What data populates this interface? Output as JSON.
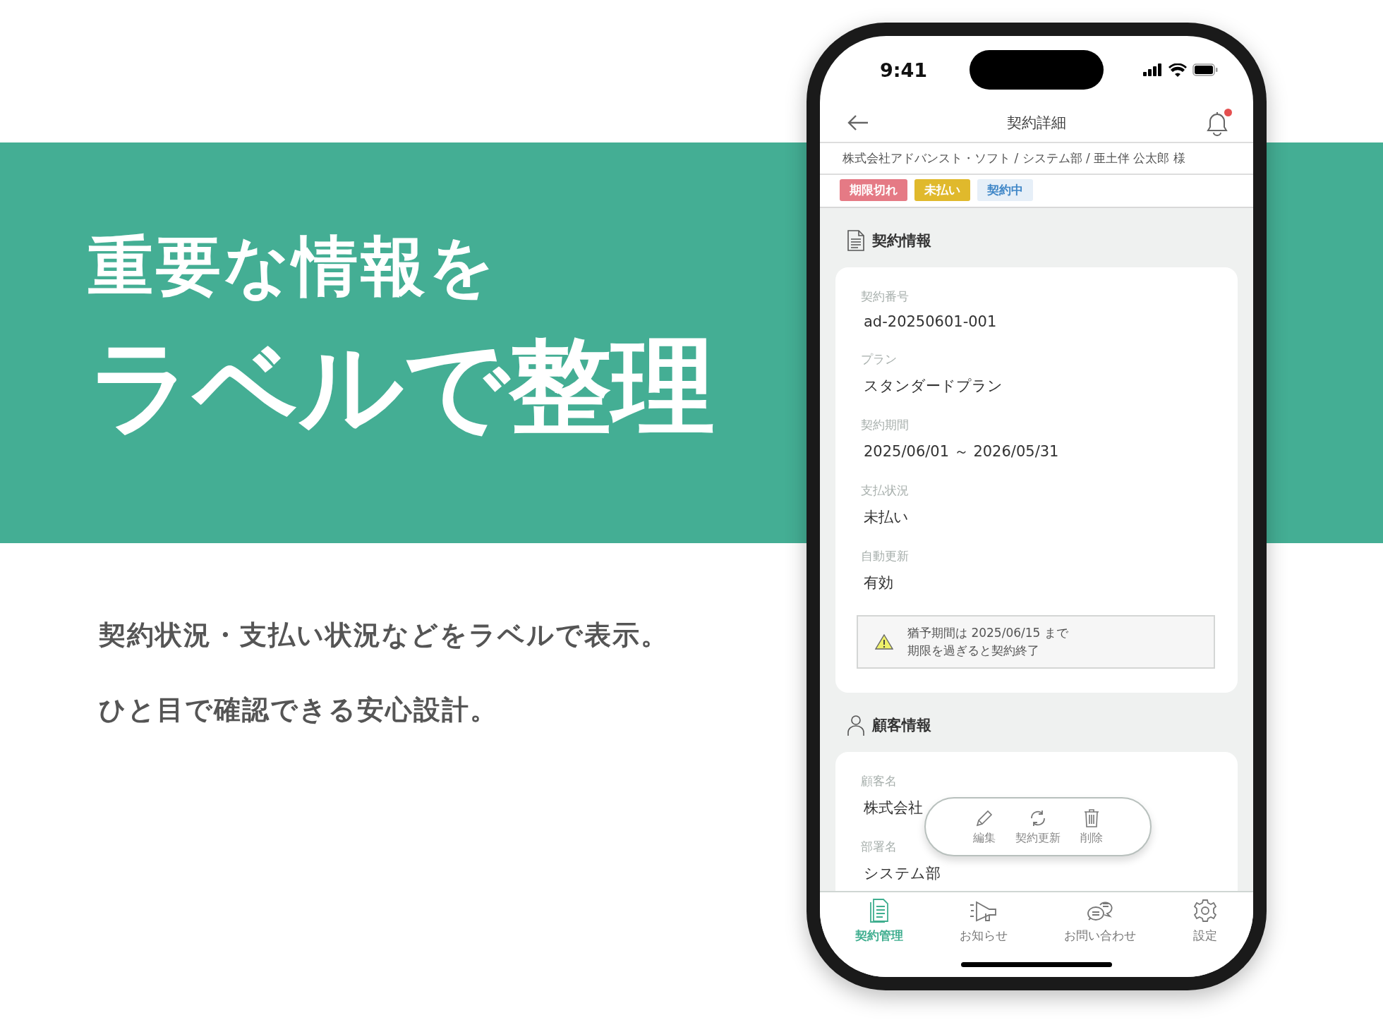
{
  "headline": {
    "line_1": "重要な情報を",
    "line_2": "ラベルで整理"
  },
  "description": [
    "契約状況・支払い状況などをラベルで表示。",
    "ひと目で確認できる安心設計。"
  ],
  "status_bar": {
    "time": "9:41"
  },
  "header": {
    "title": "契約詳細",
    "notification_badge": true
  },
  "breadcrumb": "株式会社アドバンスト・ソフト / システム部 / 亜土伴 公太郎 様",
  "labels": [
    {
      "text": "期限切れ",
      "color": "#e57a85"
    },
    {
      "text": "未払い",
      "color": "#e0b92c"
    },
    {
      "text": "契約中",
      "color": "#e6eff8"
    }
  ],
  "sections": [
    {
      "kind": "contract",
      "title": "契約情報",
      "fields": [
        {
          "label": "契約番号",
          "value": "ad-20250601-001"
        },
        {
          "label": "プラン",
          "value": "スタンダードプラン"
        },
        {
          "label": "契約期間",
          "value": "2025/06/01 ～ 2026/05/31"
        },
        {
          "label": "支払状況",
          "value": "未払い"
        },
        {
          "label": "自動更新",
          "value": "有効"
        }
      ],
      "notice": [
        "猶予期間は 2025/06/15 まで",
        "期限を過ぎると契約終了"
      ]
    },
    {
      "kind": "customer",
      "title": "顧客情報",
      "fields": [
        {
          "label": "顧客名",
          "value": "株式会社"
        },
        {
          "label": "部署名",
          "value": "システム部"
        }
      ]
    }
  ],
  "action_bar": [
    {
      "kind": "edit",
      "label": "編集"
    },
    {
      "kind": "renew",
      "label": "契約更新"
    },
    {
      "kind": "delete",
      "label": "削除"
    }
  ],
  "tab_bar": [
    {
      "kind": "contracts",
      "label": "契約管理",
      "selected": true
    },
    {
      "kind": "news",
      "label": "お知らせ",
      "selected": false
    },
    {
      "kind": "contact",
      "label": "お問い合わせ",
      "selected": false
    },
    {
      "kind": "settings",
      "label": "設定",
      "selected": false
    }
  ]
}
